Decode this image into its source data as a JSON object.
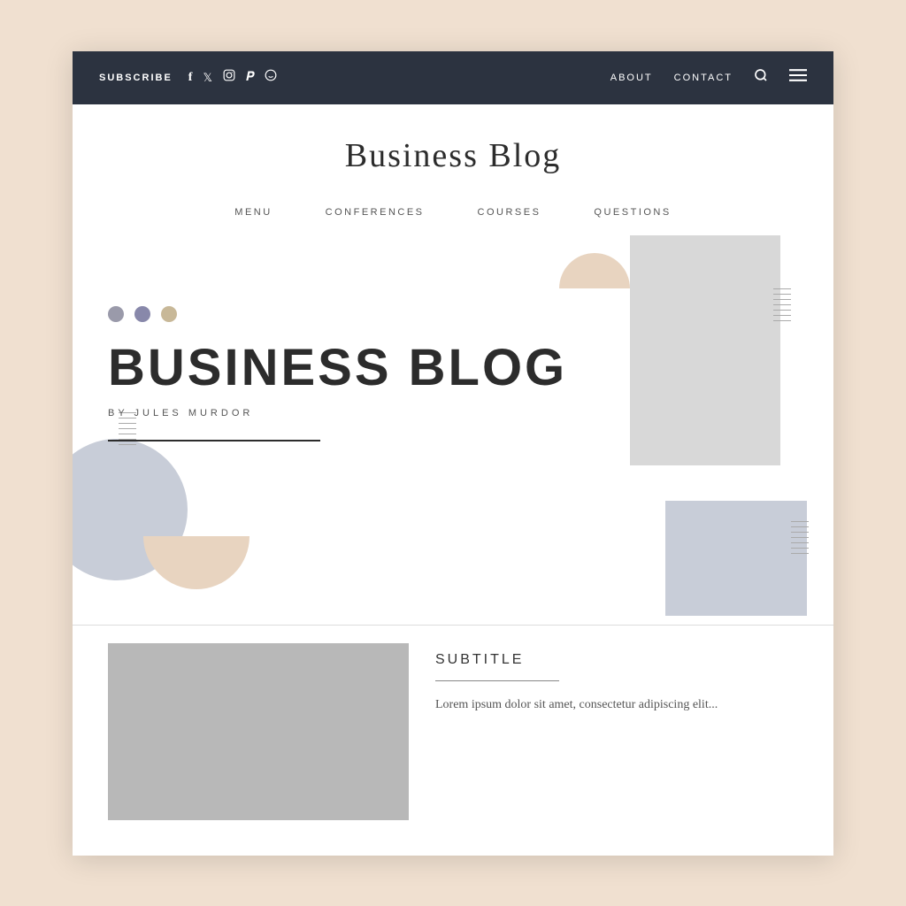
{
  "topNav": {
    "subscribe_label": "SUBSCRIBE",
    "social_icons": [
      "f",
      "𝕏",
      "◎",
      "𝒫",
      "◉"
    ],
    "about_label": "ABOUT",
    "contact_label": "CONTACT",
    "search_icon": "🔍",
    "menu_icon": "≡"
  },
  "siteTitle": "Business Blog",
  "subNav": {
    "items": [
      "MENU",
      "CONFERENCES",
      "COURSES",
      "QUESTIONS"
    ]
  },
  "hero": {
    "title": "BUSINESS BLOG",
    "subtitle": "BY JULES MURDOR"
  },
  "article": {
    "subtitle": "SUBTITLE",
    "body": "Lorem ipsum dolor sit amet, consectetur adipiscing elit..."
  },
  "colors": {
    "topNavBg": "#2c3340",
    "decoGray": "#d8d8d8",
    "decoBlue": "#c8cdd8",
    "decoTan": "#e8d4c0",
    "dotGray": "#9a9aaa",
    "dotMauve": "#8888aa",
    "dotTan": "#c8b898"
  }
}
